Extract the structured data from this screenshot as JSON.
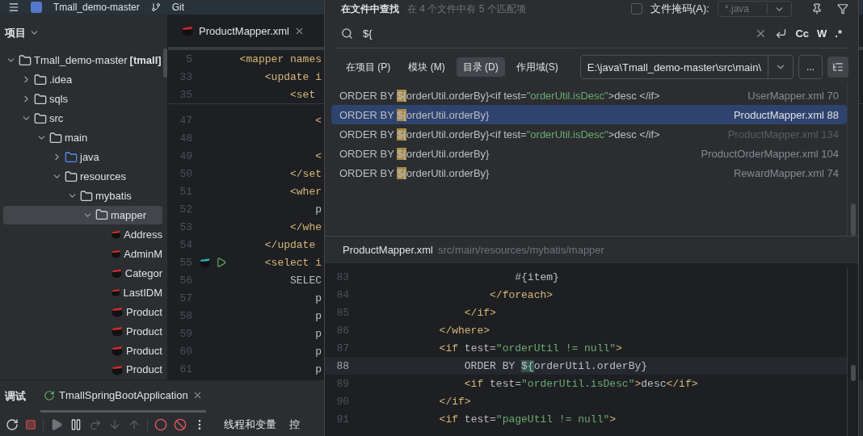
{
  "top_bar": {
    "project": "Tmall_demo-master",
    "vcs": "Git"
  },
  "project_panel": {
    "title": "项目",
    "tree": [
      {
        "label": "Tmall_demo-master",
        "suffix": "[tmall]",
        "kind": "module",
        "expanded": true,
        "selected": false,
        "children": [
          {
            "label": ".idea",
            "kind": "folder",
            "expanded": false,
            "selected": false
          },
          {
            "label": "sqls",
            "kind": "folder",
            "expanded": false,
            "selected": false
          },
          {
            "label": "src",
            "kind": "folder",
            "expanded": true,
            "selected": false,
            "children": [
              {
                "label": "main",
                "kind": "folder",
                "expanded": true,
                "selected": false,
                "children": [
                  {
                    "label": "java",
                    "kind": "source",
                    "expanded": false,
                    "selected": false
                  },
                  {
                    "label": "resources",
                    "kind": "resources",
                    "expanded": true,
                    "selected": false,
                    "children": [
                      {
                        "label": "mybatis",
                        "kind": "folder",
                        "expanded": true,
                        "selected": false,
                        "children": [
                          {
                            "label": "mapper",
                            "kind": "folder",
                            "expanded": true,
                            "selected": true,
                            "children": [
                              {
                                "label": "Address",
                                "kind": "mapper",
                                "selected": false
                              },
                              {
                                "label": "AdminM",
                                "kind": "mapper",
                                "selected": false
                              },
                              {
                                "label": "Categor",
                                "kind": "mapper",
                                "selected": false
                              },
                              {
                                "label": "LastIDM",
                                "kind": "mapper",
                                "selected": false
                              },
                              {
                                "label": "Product",
                                "kind": "mapper",
                                "selected": false
                              },
                              {
                                "label": "Product",
                                "kind": "mapper",
                                "selected": false
                              },
                              {
                                "label": "Product",
                                "kind": "mapper",
                                "selected": false
                              },
                              {
                                "label": "Product",
                                "kind": "mapper",
                                "selected": false
                              }
                            ]
                          }
                        ]
                      }
                    ]
                  }
                ]
              }
            ]
          }
        ]
      }
    ]
  },
  "editor": {
    "tab": {
      "label": "ProductMapper.xml"
    },
    "sticky_lines": [
      {
        "number": "5",
        "code": [
          {
            "kind": "tag",
            "text": "  <mapper names"
          }
        ]
      },
      {
        "number": "33",
        "code": [
          {
            "kind": "tag",
            "text": "      <update i"
          }
        ]
      },
      {
        "number": "35",
        "code": [
          {
            "kind": "tag",
            "text": "          <set"
          }
        ]
      }
    ],
    "lines": [
      {
        "number": "47",
        "code": [
          {
            "kind": "tag",
            "text": "              <"
          }
        ]
      },
      {
        "number": "48"
      },
      {
        "number": "49",
        "code": [
          {
            "kind": "tag",
            "text": "              <"
          }
        ]
      },
      {
        "number": "50",
        "code": [
          {
            "kind": "tag",
            "text": "          </set"
          }
        ]
      },
      {
        "number": "51",
        "code": [
          {
            "kind": "tag",
            "text": "          <wher"
          }
        ]
      },
      {
        "number": "52",
        "code": [
          {
            "kind": "plain",
            "text": "              p"
          }
        ]
      },
      {
        "number": "53",
        "code": [
          {
            "kind": "tag",
            "text": "          </whe"
          }
        ]
      },
      {
        "number": "54",
        "code": [
          {
            "kind": "tag",
            "text": "      </update"
          }
        ]
      },
      {
        "number": "55",
        "kind": "query",
        "code": [
          {
            "kind": "tag",
            "text": "      <select i"
          }
        ]
      },
      {
        "number": "56",
        "code": [
          {
            "kind": "plain",
            "text": "          SELEC"
          }
        ]
      },
      {
        "number": "57",
        "code": [
          {
            "kind": "plain",
            "text": "              p"
          }
        ]
      },
      {
        "number": "58",
        "code": [
          {
            "kind": "plain",
            "text": "              p"
          }
        ]
      },
      {
        "number": "59",
        "code": [
          {
            "kind": "plain",
            "text": "              p"
          }
        ]
      },
      {
        "number": "60",
        "code": [
          {
            "kind": "plain",
            "text": "              p"
          }
        ]
      },
      {
        "number": "61",
        "code": [
          {
            "kind": "plain",
            "text": "              p"
          }
        ]
      }
    ]
  },
  "debug_panel": {
    "title": "调试",
    "tab": {
      "label": "TmallSpringBootApplication"
    },
    "toolbar_label": "线程和变量",
    "cut_label": "控"
  },
  "find_popup": {
    "title": "在文件中查找",
    "summary": "在 4 个文件中有 5 个匹配项",
    "file_mask": {
      "label": "文件掩码(A):",
      "checked": false,
      "value": "*.java"
    },
    "query": "${",
    "options": [
      "Cc",
      "W",
      ".*"
    ],
    "scopes": [
      {
        "label": "在项目 (P)",
        "selected": false
      },
      {
        "label": "模块 (M)",
        "selected": false
      },
      {
        "label": "目录 (D)",
        "selected": true
      },
      {
        "label": "作用域(S)",
        "selected": false
      }
    ],
    "directory": "E:\\java\\Tmall_demo-master\\src\\main\\",
    "browse": "...",
    "results": [
      {
        "match": [
          {
            "kind": "plain",
            "text": "ORDER BY "
          },
          {
            "kind": "hit",
            "text": "${"
          },
          {
            "kind": "plain",
            "text": "orderUtil.orderBy}<if test="
          },
          {
            "kind": "string",
            "text": "\"orderUtil.isDesc\""
          },
          {
            "kind": "plain",
            "text": ">desc </if>"
          }
        ],
        "file": "UserMapper.xml 70",
        "selected": false,
        "faded": false
      },
      {
        "match": [
          {
            "kind": "plain",
            "text": "ORDER BY "
          },
          {
            "kind": "hit",
            "text": "${"
          },
          {
            "kind": "plain",
            "text": "orderUtil.orderBy}"
          }
        ],
        "file": "ProductMapper.xml 88",
        "selected": true,
        "faded": false
      },
      {
        "match": [
          {
            "kind": "plain",
            "text": "ORDER BY "
          },
          {
            "kind": "hit",
            "text": "${"
          },
          {
            "kind": "plain",
            "text": "orderUtil.orderBy}<if test="
          },
          {
            "kind": "string",
            "text": "\"orderUtil.isDesc\""
          },
          {
            "kind": "plain",
            "text": ">desc </if>"
          }
        ],
        "file": "ProductMapper.xml 134",
        "selected": false,
        "faded": true
      },
      {
        "match": [
          {
            "kind": "plain",
            "text": "ORDER BY "
          },
          {
            "kind": "hit",
            "text": "${"
          },
          {
            "kind": "plain",
            "text": "orderUtil.orderBy}"
          }
        ],
        "file": "ProductOrderMapper.xml 104",
        "selected": false,
        "faded": false
      },
      {
        "match": [
          {
            "kind": "plain",
            "text": "ORDER BY "
          },
          {
            "kind": "hit",
            "text": "${"
          },
          {
            "kind": "plain",
            "text": "orderUtil.orderBy}"
          }
        ],
        "file": "RewardMapper.xml 74",
        "selected": false,
        "faded": false
      }
    ],
    "preview": {
      "file": "ProductMapper.xml",
      "path": "src/main/resources/mybatis/mapper",
      "lines": [
        {
          "number": "83",
          "current": false,
          "code": [
            {
              "kind": "plain",
              "text": "                        #{item}"
            }
          ]
        },
        {
          "number": "84",
          "current": false,
          "code": [
            {
              "kind": "tag",
              "text": "                    </foreach>"
            }
          ]
        },
        {
          "number": "85",
          "current": false,
          "code": [
            {
              "kind": "tag",
              "text": "                </if>"
            }
          ]
        },
        {
          "number": "86",
          "current": false,
          "code": [
            {
              "kind": "tag",
              "text": "            </where>"
            }
          ]
        },
        {
          "number": "87",
          "current": false,
          "code": [
            {
              "kind": "tag",
              "text": "            <if "
            },
            {
              "kind": "attr",
              "text": "test="
            },
            {
              "kind": "string",
              "text": "\"orderUtil != null\""
            },
            {
              "kind": "tag",
              "text": ">"
            }
          ]
        },
        {
          "number": "88",
          "current": true,
          "code": [
            {
              "kind": "plain",
              "text": "                ORDER BY "
            },
            {
              "kind": "hit",
              "text": "${"
            },
            {
              "kind": "plain",
              "text": "orderUtil.orderBy}"
            }
          ]
        },
        {
          "number": "89",
          "current": false,
          "code": [
            {
              "kind": "tag",
              "text": "                <if "
            },
            {
              "kind": "attr",
              "text": "test="
            },
            {
              "kind": "string",
              "text": "\"orderUtil.isDesc\""
            },
            {
              "kind": "tag",
              "text": ">"
            },
            {
              "kind": "plain",
              "text": "desc"
            },
            {
              "kind": "tag",
              "text": "</if>"
            }
          ]
        },
        {
          "number": "90",
          "current": false,
          "code": [
            {
              "kind": "tag",
              "text": "            </if>"
            }
          ]
        },
        {
          "number": "91",
          "current": false,
          "code": [
            {
              "kind": "tag",
              "text": "            <if "
            },
            {
              "kind": "attr",
              "text": "test="
            },
            {
              "kind": "string",
              "text": "\"pageUtil != null\""
            },
            {
              "kind": "tag",
              "text": ">"
            }
          ]
        }
      ]
    }
  }
}
